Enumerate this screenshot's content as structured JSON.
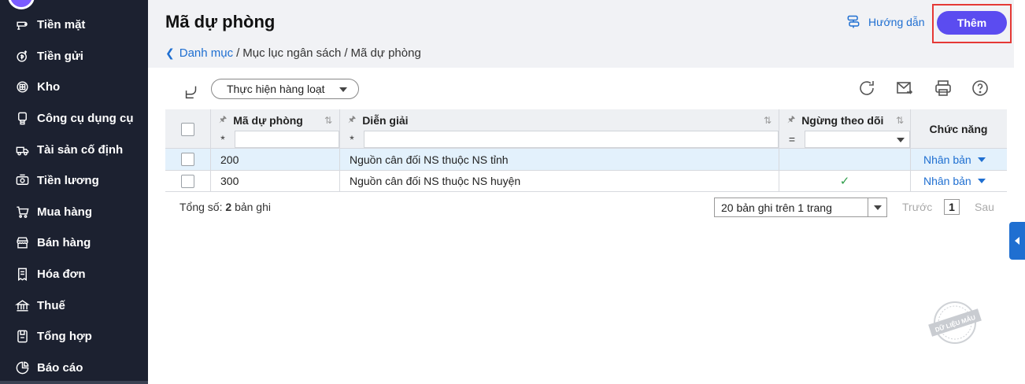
{
  "sidebar": {
    "items": [
      {
        "label": "Tiền mặt",
        "icon": "cash-icon"
      },
      {
        "label": "Tiền gửi",
        "icon": "deposit-icon"
      },
      {
        "label": "Kho",
        "icon": "warehouse-icon"
      },
      {
        "label": "Công cụ dụng cụ",
        "icon": "tools-icon"
      },
      {
        "label": "Tài sản cố định",
        "icon": "fixed-asset-icon"
      },
      {
        "label": "Tiền lương",
        "icon": "salary-icon"
      },
      {
        "label": "Mua hàng",
        "icon": "cart-icon"
      },
      {
        "label": "Bán hàng",
        "icon": "store-icon"
      },
      {
        "label": "Hóa đơn",
        "icon": "invoice-icon"
      },
      {
        "label": "Thuế",
        "icon": "tax-icon"
      },
      {
        "label": "Tổng hợp",
        "icon": "summary-icon"
      },
      {
        "label": "Báo cáo",
        "icon": "report-icon"
      }
    ]
  },
  "header": {
    "title": "Mã dự phòng",
    "breadcrumb": {
      "root": "Danh mục",
      "parent": "Mục lục ngân sách",
      "current": "Mã dự phòng",
      "separator": "/"
    },
    "help_label": "Hướng dẫn",
    "add_label": "Thêm"
  },
  "toolbar": {
    "bulk_action_label": "Thực hiện hàng loạt"
  },
  "table": {
    "columns": {
      "code": "Mã dự phòng",
      "description": "Diễn giải",
      "inactive": "Ngừng theo dõi",
      "actions": "Chức năng"
    },
    "filters": {
      "code_op": "*",
      "description_op": "*",
      "inactive_op": "="
    },
    "rows": [
      {
        "code": "200",
        "description": "Nguồn cân đối NS thuộc NS tỉnh",
        "inactive": "",
        "action": "Nhân bản"
      },
      {
        "code": "300",
        "description": "Nguồn cân đối NS thuộc NS huyện",
        "inactive": "✓",
        "action": "Nhân bản"
      }
    ]
  },
  "footer": {
    "total_label": "Tổng số:",
    "total_count": "2",
    "total_unit": "bản ghi",
    "page_size": "20 bản ghi trên 1 trang",
    "prev": "Trước",
    "page": "1",
    "next": "Sau"
  },
  "watermark": "DỮ LIỆU MẪU",
  "colors": {
    "sidebar": "#1c2130",
    "accent": "#5b4cf0",
    "link": "#1f6fd1",
    "highlight": "#e53935"
  }
}
